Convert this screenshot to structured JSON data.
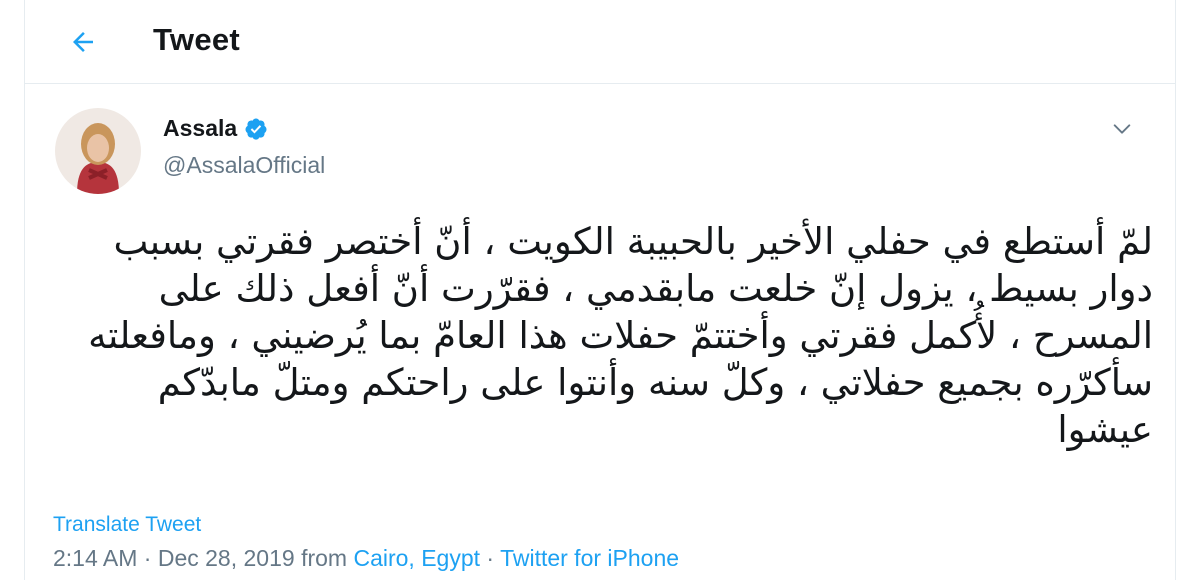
{
  "header": {
    "title": "Tweet",
    "back_icon": "arrow-left-icon"
  },
  "author": {
    "name": "Assala",
    "handle": "@AssalaOfficial",
    "verified_icon": "verified-badge-icon"
  },
  "tweet": {
    "text": "لمّ أستطع في حفلي الأخير بالحبيبة الكويت ، أنّ أختصر فقرتي بسبب دوار بسيط ، يزول إنّ خلعت مابقدمي ، فقرّرت أنّ أفعل ذلك على المسرح ، لأُكمل فقرتي وأختتمّ حفلات هذا العامّ بما يُرضيني ، ومافعلته سأكرّره بجميع حفلاتي ، وكلّ سنه وأنتوا على راحتكم ومتلّ مابدّكم عيشوا",
    "translate_label": "Translate Tweet",
    "time": "2:14 AM",
    "separator": "·",
    "date": "Dec 28, 2019",
    "from_label": "from",
    "location": "Cairo, Egypt",
    "source": "Twitter for iPhone"
  },
  "colors": {
    "accent": "#1da1f2",
    "secondary_text": "#657786",
    "border": "#e6ecf0"
  }
}
